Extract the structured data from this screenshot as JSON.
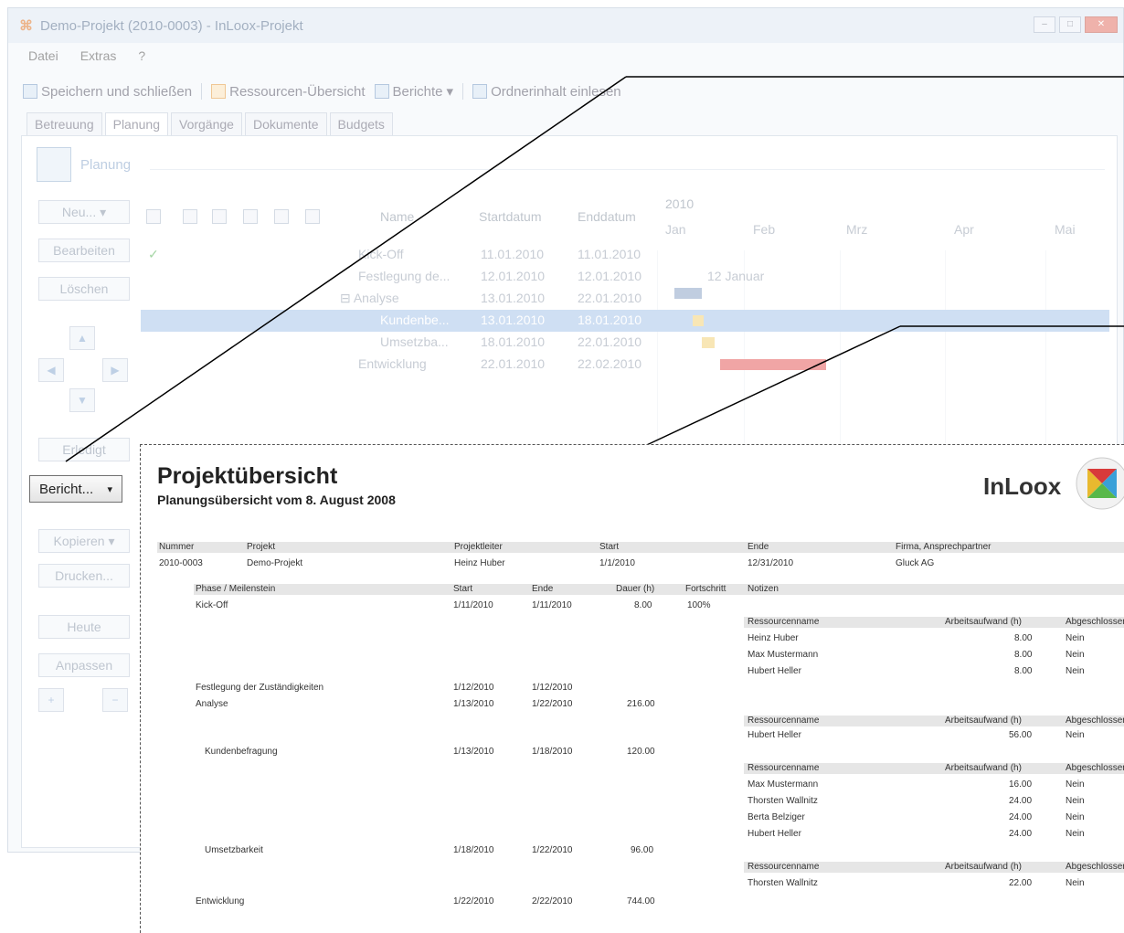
{
  "window": {
    "title": "Demo-Projekt (2010-0003) - InLoox-Projekt",
    "logo": "⌘"
  },
  "menu": [
    "Datei",
    "Extras",
    "?"
  ],
  "toolbar": {
    "save": "Speichern und schließen",
    "resources": "Ressourcen-Übersicht",
    "reports": "Berichte",
    "reports_arrow": "▾",
    "folder": "Ordnerinhalt einlesen"
  },
  "tabs": [
    "Betreuung",
    "Planung",
    "Vorgänge",
    "Dokumente",
    "Budgets"
  ],
  "section": {
    "title": "Planung"
  },
  "left_buttons": {
    "new": "Neu...",
    "new_arrow": "▾",
    "edit": "Bearbeiten",
    "delete": "Löschen",
    "done": "Erledigt",
    "report": "Bericht...",
    "report_arrow": "▾",
    "copy": "Kopieren",
    "copy_arrow": "▾",
    "print": "Drucken...",
    "today": "Heute",
    "adjust": "Anpassen"
  },
  "grid": {
    "headers": {
      "name": "Name",
      "start": "Startdatum",
      "end": "Enddatum"
    },
    "year": "2010",
    "months": [
      "Jan",
      "Feb",
      "Mrz",
      "Apr",
      "Mai"
    ],
    "rows": [
      {
        "name": "Kick-Off",
        "start": "11.01.2010",
        "end": "11.01.2010",
        "check": "✓",
        "selected": false
      },
      {
        "name": "Festlegung de...",
        "start": "12.01.2010",
        "end": "12.01.2010",
        "check": "",
        "selected": false
      },
      {
        "name": "⊟ Analyse",
        "start": "13.01.2010",
        "end": "22.01.2010",
        "check": "",
        "selected": false
      },
      {
        "name": "Kundenbe...",
        "start": "13.01.2010",
        "end": "18.01.2010",
        "check": "",
        "selected": true
      },
      {
        "name": "Umsetzba...",
        "start": "18.01.2010",
        "end": "22.01.2010",
        "check": "",
        "selected": false
      },
      {
        "name": "Entwicklung",
        "start": "22.01.2010",
        "end": "22.02.2010",
        "check": "",
        "selected": false
      }
    ],
    "milestone_label": "12 Januar"
  },
  "report": {
    "title": "Projektübersicht",
    "subtitle": "Planungsübersicht vom 8. August 2008",
    "brand": "InLoox",
    "project_headers": [
      "Nummer",
      "Projekt",
      "Projektleiter",
      "Start",
      "Ende",
      "Firma, Ansprechpartner"
    ],
    "project_values": [
      "2010-0003",
      "Demo-Projekt",
      "Heinz Huber",
      "1/1/2010",
      "12/31/2010",
      "Gluck AG"
    ],
    "phase_headers": [
      "Phase / Meilenstein",
      "Start",
      "Ende",
      "Dauer (h)",
      "Fortschritt",
      "Notizen"
    ],
    "phases": [
      {
        "name": "Kick-Off",
        "start": "1/11/2010",
        "end": "1/11/2010",
        "dur": "8.00",
        "prog": "100%"
      },
      {
        "name": "Festlegung der Zuständigkeiten",
        "start": "1/12/2010",
        "end": "1/12/2010",
        "dur": "",
        "prog": ""
      },
      {
        "name": "Analyse",
        "start": "1/13/2010",
        "end": "1/22/2010",
        "dur": "216.00",
        "prog": ""
      },
      {
        "name": "Kundenbefragung",
        "start": "1/13/2010",
        "end": "1/18/2010",
        "dur": "120.00",
        "prog": ""
      },
      {
        "name": "Umsetzbarkeit",
        "start": "1/18/2010",
        "end": "1/22/2010",
        "dur": "96.00",
        "prog": ""
      },
      {
        "name": "Entwicklung",
        "start": "1/22/2010",
        "end": "2/22/2010",
        "dur": "744.00",
        "prog": ""
      }
    ],
    "res_headers": [
      "Ressourcenname",
      "Arbeitsaufwand (h)",
      "Abgeschlossen"
    ],
    "res_groups": [
      [
        {
          "n": "Heinz Huber",
          "h": "8.00",
          "a": "Nein"
        },
        {
          "n": "Max Mustermann",
          "h": "8.00",
          "a": "Nein"
        },
        {
          "n": "Hubert Heller",
          "h": "8.00",
          "a": "Nein"
        }
      ],
      [
        {
          "n": "Hubert Heller",
          "h": "56.00",
          "a": "Nein"
        }
      ],
      [
        {
          "n": "Max Mustermann",
          "h": "16.00",
          "a": "Nein"
        },
        {
          "n": "Thorsten Wallnitz",
          "h": "24.00",
          "a": "Nein"
        },
        {
          "n": "Berta Belziger",
          "h": "24.00",
          "a": "Nein"
        },
        {
          "n": "Hubert Heller",
          "h": "24.00",
          "a": "Nein"
        }
      ],
      [
        {
          "n": "Thorsten Wallnitz",
          "h": "22.00",
          "a": "Nein"
        }
      ]
    ]
  }
}
